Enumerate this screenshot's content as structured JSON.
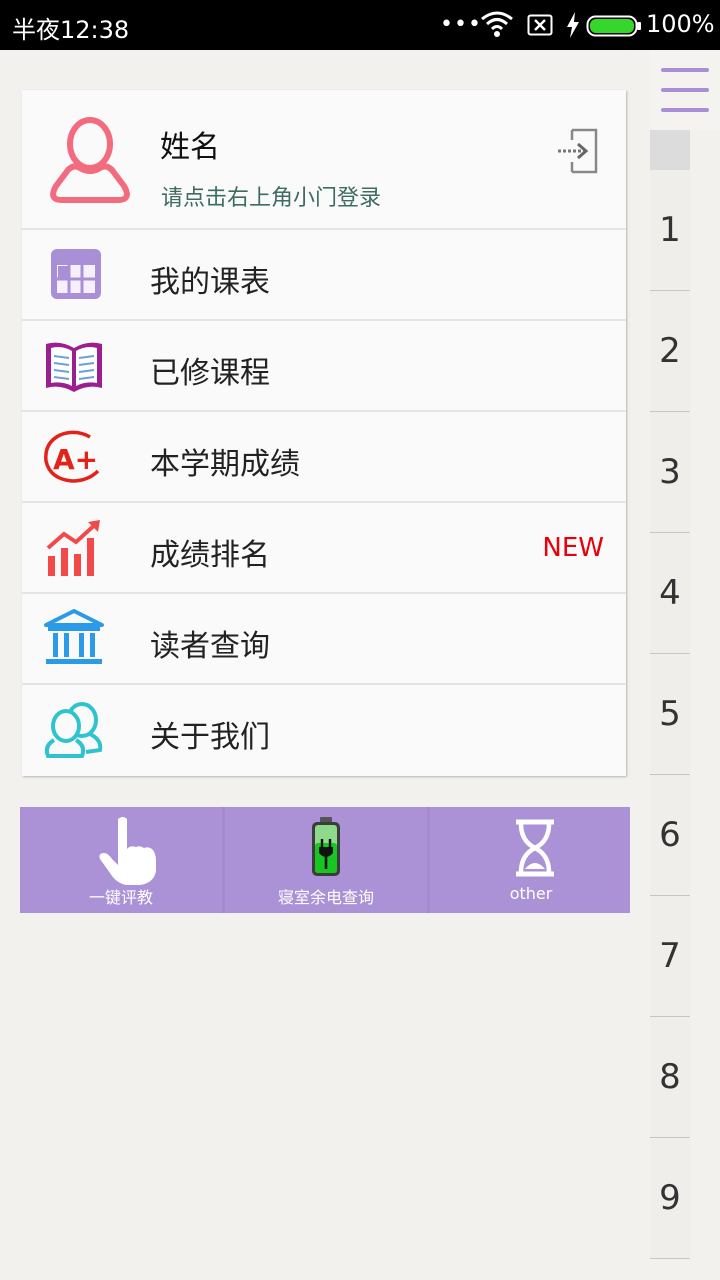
{
  "status_bar": {
    "time": "半夜12:38",
    "battery_percent": "100%",
    "battery_level": 1.0
  },
  "profile": {
    "name": "姓名",
    "hint": "请点击右上角小门登录",
    "avatar_icon": "user-avatar-icon",
    "login_icon": "login-door-icon"
  },
  "menu": [
    {
      "label": "我的课表",
      "icon": "timetable-icon"
    },
    {
      "label": "已修课程",
      "icon": "open-book-icon"
    },
    {
      "label": "本学期成绩",
      "icon": "a-plus-grade-icon"
    },
    {
      "label": "成绩排名",
      "icon": "rising-chart-icon",
      "badge": "NEW"
    },
    {
      "label": "读者查询",
      "icon": "library-building-icon"
    },
    {
      "label": "关于我们",
      "icon": "people-icon"
    }
  ],
  "quick_actions": [
    {
      "label": "一键评教",
      "icon": "pointing-hand-icon"
    },
    {
      "label": "寝室余电查询",
      "icon": "battery-charging-icon"
    },
    {
      "label": "other",
      "icon": "hourglass-icon"
    }
  ],
  "side_index": [
    "1",
    "2",
    "3",
    "4",
    "5",
    "6",
    "7",
    "8",
    "9"
  ],
  "colors": {
    "accent": "#ab92d6",
    "badge": "#e8000a",
    "hint_text": "#3e6b62",
    "background": "#f2f1ee"
  }
}
